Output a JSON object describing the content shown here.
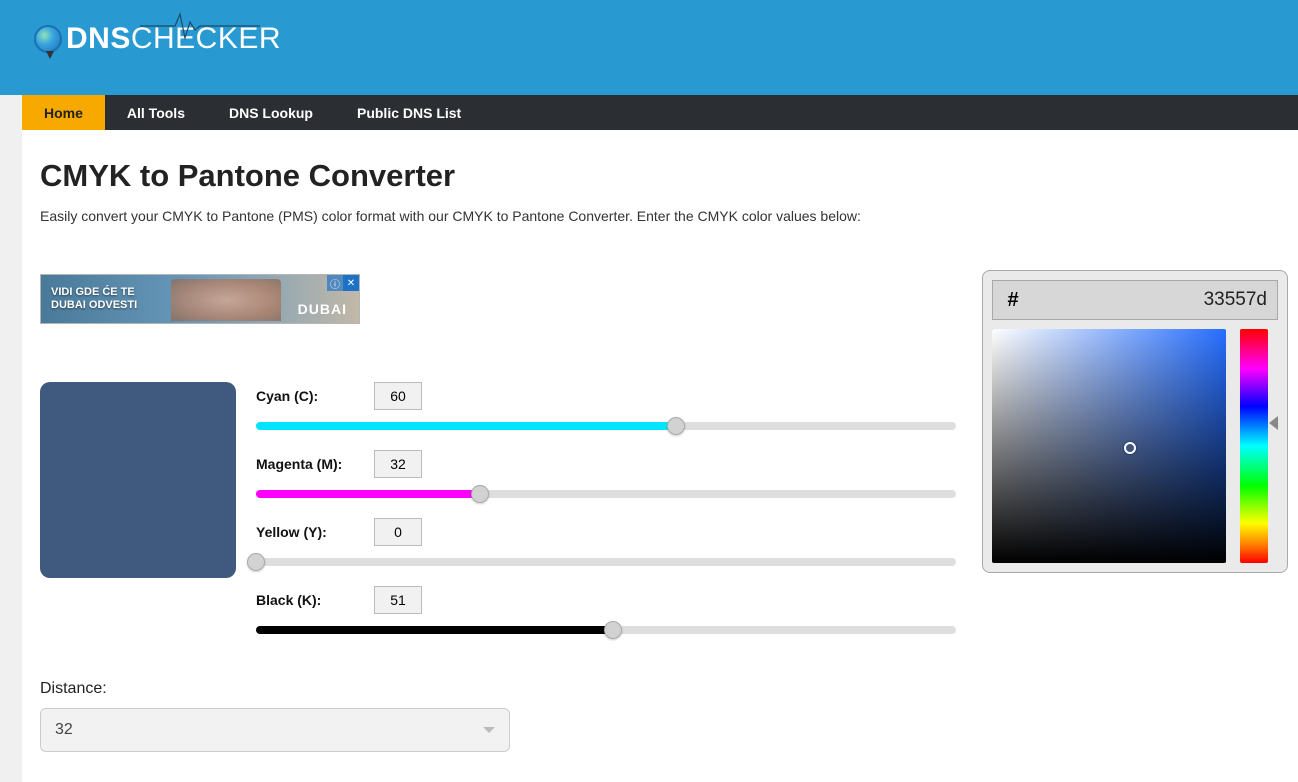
{
  "logo": {
    "part1": "DNS",
    "part2": "CHECKER"
  },
  "nav": {
    "items": [
      {
        "label": "Home",
        "active": true
      },
      {
        "label": "All Tools",
        "active": false
      },
      {
        "label": "DNS Lookup",
        "active": false
      },
      {
        "label": "Public DNS List",
        "active": false
      }
    ]
  },
  "page": {
    "title": "CMYK to Pantone Converter",
    "description": "Easily convert your CMYK to Pantone (PMS) color format with our CMYK to Pantone Converter. Enter the CMYK color values below:"
  },
  "ad": {
    "line1": "VIDI GDE ĆE TE",
    "line2": "DUBAI ODVESTI",
    "brand": "DUBAI",
    "close": "✕",
    "info": "ⓘ"
  },
  "swatch_color": "#40597e",
  "sliders": {
    "cyan": {
      "label": "Cyan (C):",
      "value": "60",
      "percent": 60,
      "fill_color": "#00e5ff"
    },
    "magenta": {
      "label": "Magenta (M):",
      "value": "32",
      "percent": 32,
      "fill_color": "#ff00ff"
    },
    "yellow": {
      "label": "Yellow (Y):",
      "value": "0",
      "percent": 0,
      "fill_color": "#ffff00"
    },
    "black": {
      "label": "Black (K):",
      "value": "51",
      "percent": 51,
      "fill_color": "#000000"
    }
  },
  "distance": {
    "label": "Distance:",
    "selected": "32"
  },
  "picker": {
    "hash": "#",
    "hex": "33557d",
    "sv_base_hue_color": "#266eff",
    "sv_cursor": {
      "x_percent": 59,
      "y_percent": 51
    },
    "hue_pointer_percent": 40
  }
}
